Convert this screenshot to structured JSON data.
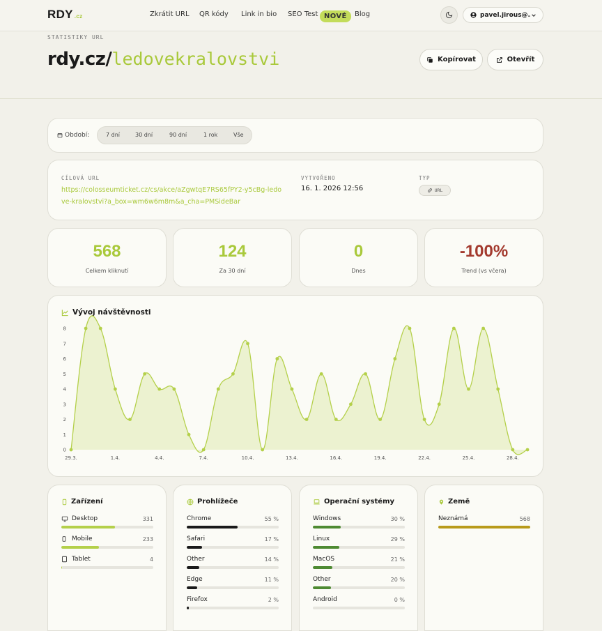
{
  "header": {
    "logo": "RDY",
    "logo_sub": ".cz",
    "nav": [
      "Zkrátit URL",
      "QR kódy",
      "Link in bio",
      "SEO Test",
      "Blog"
    ],
    "new_badge": "NOVÉ",
    "user": "pavel.jirous@..."
  },
  "page": {
    "subtitle": "STATISTIKY URL",
    "domain": "rdy.cz/",
    "slug": "ledovekralovstvi",
    "copy_label": "Kopírovat",
    "open_label": "Otevřít"
  },
  "period": {
    "label": "Období:",
    "options": [
      "7 dní",
      "30 dní",
      "90 dní",
      "1 rok",
      "Vše"
    ]
  },
  "info": {
    "target_label": "CÍLOVÁ URL",
    "target_url": "https://colosseumticket.cz/cs/akce/aZgwtqE7RS65fPY2-y5cBg-ledove-kralovstvi?a_box=wm6w6m8m&a_cha=PMSideBar",
    "created_label": "VYTVOŘENO",
    "created_value": "16. 1. 2026 12:56",
    "type_label": "TYP",
    "type_value": "URL"
  },
  "stats": [
    {
      "value": "568",
      "label": "Celkem kliknutí"
    },
    {
      "value": "124",
      "label": "Za 30 dní"
    },
    {
      "value": "0",
      "label": "Dnes"
    },
    {
      "value": "-100%",
      "label": "Trend (vs včera)"
    }
  ],
  "chart_data": {
    "type": "area",
    "title": "Vývoj návštěvnosti",
    "x_tick_labels": [
      "29.3.",
      "1.4.",
      "4.4.",
      "7.4.",
      "10.4.",
      "13.4.",
      "16.4.",
      "19.4.",
      "22.4.",
      "25.4.",
      "28.4."
    ],
    "y_ticks": [
      0,
      1,
      2,
      3,
      4,
      5,
      6,
      7,
      8
    ],
    "ylim": [
      0,
      8
    ],
    "values": [
      0,
      8,
      8,
      4,
      2,
      5,
      4,
      4,
      1,
      0,
      4,
      5,
      7,
      0,
      6,
      4,
      2,
      5,
      2,
      3,
      5,
      2,
      6,
      8,
      2,
      3,
      8,
      4,
      8,
      4,
      0,
      0
    ],
    "grid": false,
    "color": "#b4d04a"
  },
  "panels": {
    "devices": {
      "title": "Zařízení",
      "color": "#b4d04a",
      "items": [
        {
          "label": "Desktop",
          "value": "331",
          "pct": 58,
          "icon": "desktop-icon"
        },
        {
          "label": "Mobile",
          "value": "233",
          "pct": 41,
          "icon": "mobile-icon"
        },
        {
          "label": "Tablet",
          "value": "4",
          "pct": 1,
          "icon": "tablet-icon"
        }
      ]
    },
    "browsers": {
      "title": "Prohlížeče",
      "color": "#1a1a1a",
      "items": [
        {
          "label": "Chrome",
          "value": "55 %",
          "pct": 55
        },
        {
          "label": "Safari",
          "value": "17 %",
          "pct": 17
        },
        {
          "label": "Other",
          "value": "14 %",
          "pct": 14
        },
        {
          "label": "Edge",
          "value": "11 %",
          "pct": 11
        },
        {
          "label": "Firefox",
          "value": "2 %",
          "pct": 2
        }
      ]
    },
    "os": {
      "title": "Operační systémy",
      "color": "#4e8a32",
      "items": [
        {
          "label": "Windows",
          "value": "30 %",
          "pct": 30
        },
        {
          "label": "Linux",
          "value": "29 %",
          "pct": 29
        },
        {
          "label": "MacOS",
          "value": "21 %",
          "pct": 21
        },
        {
          "label": "Other",
          "value": "20 %",
          "pct": 20
        },
        {
          "label": "Android",
          "value": "0 %",
          "pct": 0
        }
      ]
    },
    "countries": {
      "title": "Země",
      "color": "#b89a1a",
      "items": [
        {
          "label": "Neznámá",
          "value": "568",
          "pct": 100
        }
      ]
    }
  }
}
